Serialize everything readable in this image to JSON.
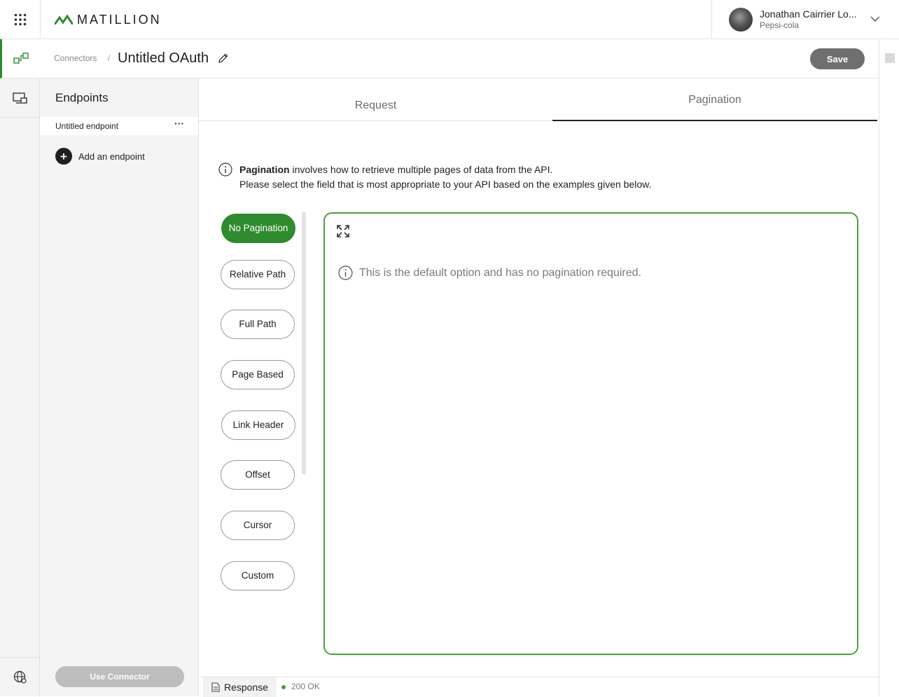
{
  "brand": {
    "logo_text": "MATILLION",
    "accent": "#2e8b2e"
  },
  "user": {
    "name": "Jonathan Cairrier Lo...",
    "org": "Pepsi-cola"
  },
  "header": {
    "breadcrumb": "Connectors",
    "separator": "/",
    "title": "Untitled OAuth",
    "save_label": "Save"
  },
  "endpoints": {
    "title": "Endpoints",
    "items": [
      {
        "label": "Untitled endpoint",
        "more": "···"
      }
    ],
    "add_label": "Add an endpoint",
    "use_connector_label": "Use Connector"
  },
  "tabs": [
    {
      "label": "Request"
    },
    {
      "label": "Pagination"
    }
  ],
  "pagination": {
    "info_bold": "Pagination",
    "info_line1": " involves how to retrieve multiple pages of data from the API.",
    "info_line2": "Please select the field that is most appropriate to your API based on the examples given below.",
    "options": [
      {
        "label": "No Pagination",
        "selected": true
      },
      {
        "label": "Relative Path"
      },
      {
        "label": "Full Path"
      },
      {
        "label": "Page Based"
      },
      {
        "label": "Link Header"
      },
      {
        "label": "Offset"
      },
      {
        "label": "Cursor"
      },
      {
        "label": "Custom"
      }
    ],
    "panel_text": "This is the default option and has no pagination required."
  },
  "response": {
    "tab_label": "Response",
    "status": "200 OK",
    "status_color": "#3aa63a"
  }
}
